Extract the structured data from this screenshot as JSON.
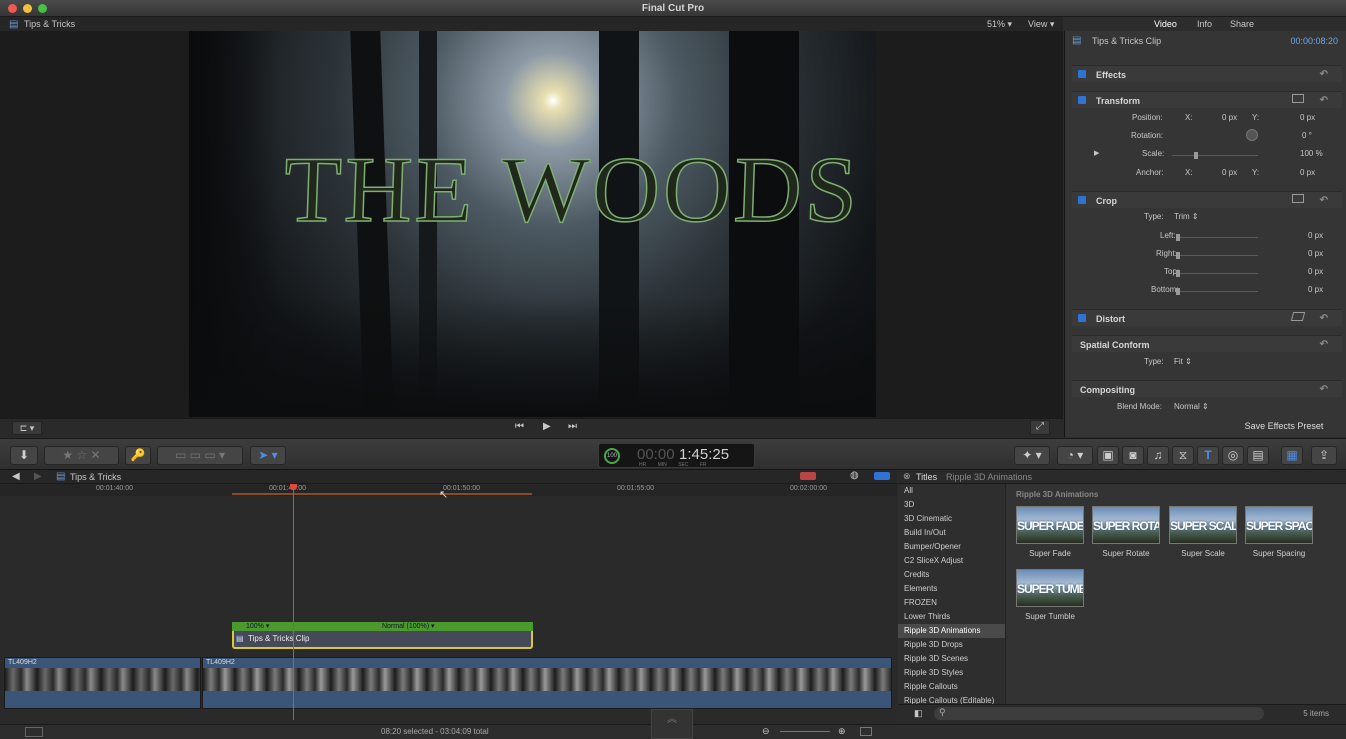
{
  "app": {
    "title": "Final Cut Pro"
  },
  "viewer": {
    "event_name": "Tips & Tricks",
    "zoom": "51%",
    "view_menu": "View",
    "overlay_title": "THE WOODS"
  },
  "inspector": {
    "tabs": [
      "Video",
      "Info",
      "Share"
    ],
    "clip_name": "Tips & Tricks Clip",
    "clip_duration": "00:00:08:20",
    "effects": "Effects",
    "transform": {
      "title": "Transform",
      "position_label": "Position:",
      "x_label": "X:",
      "x_value": "0 px",
      "y_label": "Y:",
      "y_value": "0 px",
      "rotation_label": "Rotation:",
      "rotation_value": "0 °",
      "scale_label": "Scale:",
      "scale_value": "100 %",
      "anchor_label": "Anchor:",
      "anchor_x": "0 px",
      "anchor_y": "0 px"
    },
    "crop": {
      "title": "Crop",
      "type_label": "Type:",
      "type_value": "Trim",
      "left_label": "Left:",
      "left_value": "0 px",
      "right_label": "Right:",
      "right_value": "0 px",
      "top_label": "Top:",
      "top_value": "0 px",
      "bottom_label": "Bottom:",
      "bottom_value": "0 px"
    },
    "distort": "Distort",
    "spatial": {
      "title": "Spatial Conform",
      "type_label": "Type:",
      "type_value": "Fit"
    },
    "compositing": {
      "title": "Compositing",
      "blend_label": "Blend Mode:",
      "blend_value": "Normal"
    },
    "save_preset": "Save Effects Preset"
  },
  "toolbar": {
    "timecode": "1:45:25",
    "timecode_dim": "00:00",
    "timecode_percent": "100",
    "timecode_units": [
      "HR",
      "MIN",
      "SEC",
      "FR"
    ]
  },
  "timeline": {
    "project_name": "Tips & Tricks",
    "ruler_ticks": [
      "00:01:40:00",
      "00:01:45:00",
      "00:01:50:00",
      "00:01:55:00",
      "00:02:00:00"
    ],
    "title_clip": "Tips & Tricks Clip",
    "retime_left": "100% ▾",
    "retime_right": "Normal (100%) ▾",
    "video_clip_1": "TL409H2",
    "video_clip_2": "TL409H2"
  },
  "browser": {
    "header": "Titles",
    "breadcrumb": "Ripple 3D Animations",
    "section_title": "Ripple 3D Animations",
    "categories": [
      "All",
      "3D",
      "3D Cinematic",
      "Build In/Out",
      "Bumper/Opener",
      "C2 SliceX Adjust",
      "Credits",
      "Elements",
      "FROZEN",
      "Lower Thirds",
      "Ripple 3D Animations",
      "Ripple 3D Drops",
      "Ripple 3D Scenes",
      "Ripple 3D Styles",
      "Ripple Callouts",
      "Ripple Callouts (Editable)"
    ],
    "selected_category": "Ripple 3D Animations",
    "items": [
      {
        "thumb": "SUPER FADE",
        "label": "Super Fade"
      },
      {
        "thumb": "SUPER ROTATE",
        "label": "Super Rotate"
      },
      {
        "thumb": "SUPER SCALE",
        "label": "Super Scale"
      },
      {
        "thumb": "SUPER SPACING",
        "label": "Super Spacing"
      },
      {
        "thumb": "SUPER TUMBLE",
        "label": "Super Tumble"
      }
    ],
    "item_count": "5 items"
  },
  "status": {
    "selection": "08:20 selected - 03:04:09 total"
  },
  "colors": {
    "accent": "#2f73d9",
    "playhead": "#e0443a",
    "title_clip": "#4a9a2e",
    "video_track": "#3b5578"
  }
}
